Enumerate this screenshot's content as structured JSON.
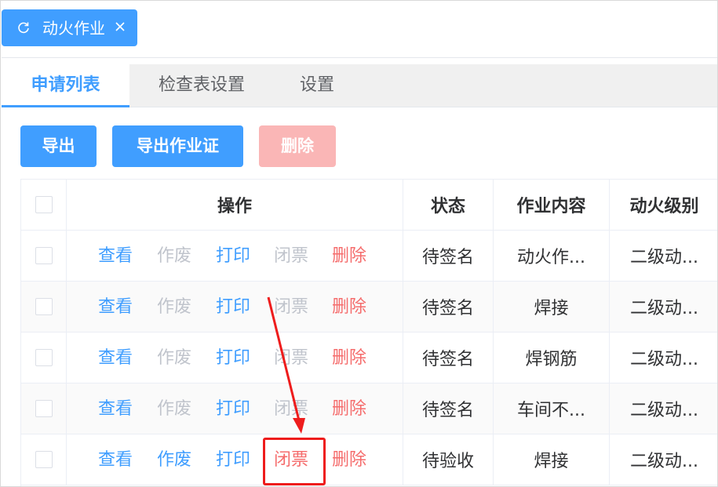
{
  "page_tab": {
    "title": "动火作业",
    "icon": "refresh-icon",
    "close_icon": "close-icon"
  },
  "tabs": [
    "申请列表",
    "检查表设置",
    "设置"
  ],
  "toolbar": {
    "export": "导出",
    "export_permit": "导出作业证",
    "delete": "删除"
  },
  "table": {
    "headers": {
      "actions": "操作",
      "status": "状态",
      "content": "作业内容",
      "level": "动火级别"
    },
    "rows": [
      {
        "actions": [
          "查看",
          "作废",
          "打印",
          "闭票",
          "删除"
        ],
        "status": "待签名",
        "content": "动火作...",
        "level": "二级动..."
      },
      {
        "actions": [
          "查看",
          "作废",
          "打印",
          "闭票",
          "删除"
        ],
        "status": "待签名",
        "content": "焊接",
        "level": "二级动..."
      },
      {
        "actions": [
          "查看",
          "作废",
          "打印",
          "闭票",
          "删除"
        ],
        "status": "待签名",
        "content": "焊钢筋",
        "level": "二级动..."
      },
      {
        "actions": [
          "查看",
          "作废",
          "打印",
          "闭票",
          "删除"
        ],
        "status": "待签名",
        "content": "车间不...",
        "level": "二级动..."
      },
      {
        "actions": [
          "查看",
          "作废",
          "打印",
          "闭票",
          "删除"
        ],
        "status": "待验收",
        "content": "焊接",
        "level": "二级动..."
      }
    ]
  },
  "colors": {
    "primary": "#409eff",
    "danger": "#f56c6c",
    "disabled_text": "#c0c4cc",
    "disabled_delete_bg": "#fab6b6",
    "annotation": "#ee1c1c"
  }
}
